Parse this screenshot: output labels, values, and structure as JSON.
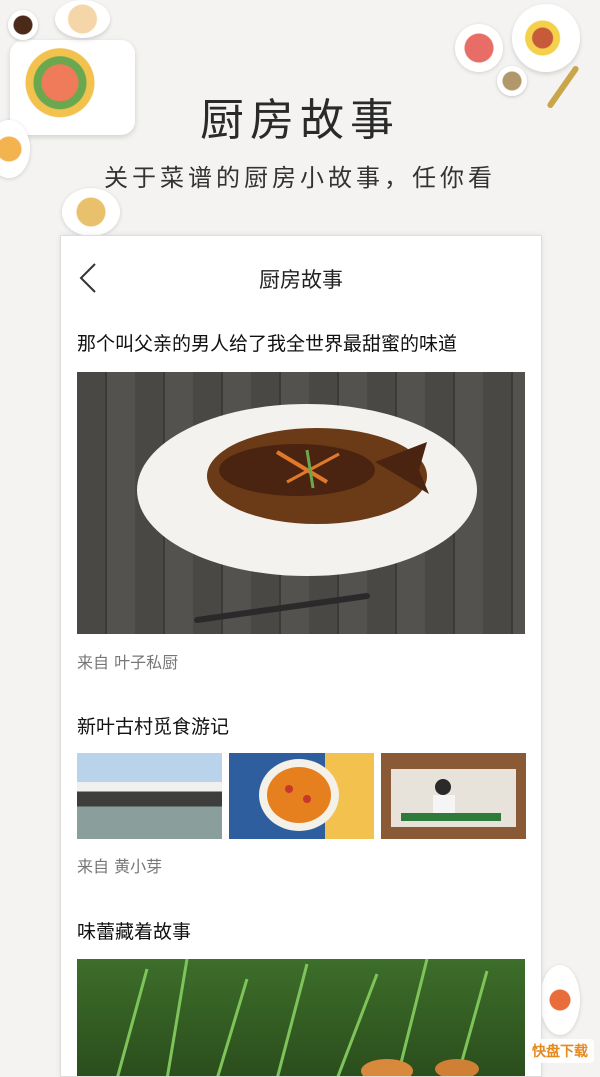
{
  "promo": {
    "title": "厨房故事",
    "subtitle": "关于菜谱的厨房小故事，任你看"
  },
  "nav": {
    "back_icon": "chevron-left-icon",
    "title": "厨房故事"
  },
  "stories": [
    {
      "title": "那个叫父亲的男人给了我全世界最甜蜜的味道",
      "source": "来自  叶子私厨"
    },
    {
      "title": "新叶古村觅食游记",
      "source": "来自  黄小芽"
    },
    {
      "title": "味蕾藏着故事"
    }
  ],
  "watermark": "快盘下载",
  "colors": {
    "background": "#f4f3f1",
    "card": "#ffffff",
    "accent": "#e58a1f"
  }
}
